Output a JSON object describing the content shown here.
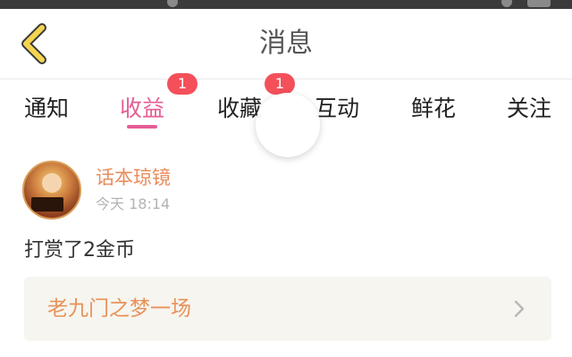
{
  "header": {
    "title": "消息"
  },
  "tabs": [
    {
      "label": "通知",
      "active": false,
      "badge": ""
    },
    {
      "label": "收益",
      "active": true,
      "badge": "1"
    },
    {
      "label": "收藏",
      "active": false,
      "badge": "1"
    },
    {
      "label": "互动",
      "active": false,
      "badge": ""
    },
    {
      "label": "鲜花",
      "active": false,
      "badge": ""
    },
    {
      "label": "关注",
      "active": false,
      "badge": ""
    }
  ],
  "notification": {
    "username": "话本琼镜",
    "time": "今天 18:14",
    "message": "打赏了2金币",
    "work_title": "老九门之梦一场"
  },
  "colors": {
    "accent_pink": "#e65d95",
    "badge_red": "#f4505a",
    "back_icon": "#f5d54f",
    "orange_text": "#e98c5b"
  },
  "icons": {
    "back": "chevron-left-icon",
    "forward": "chevron-right-icon"
  }
}
